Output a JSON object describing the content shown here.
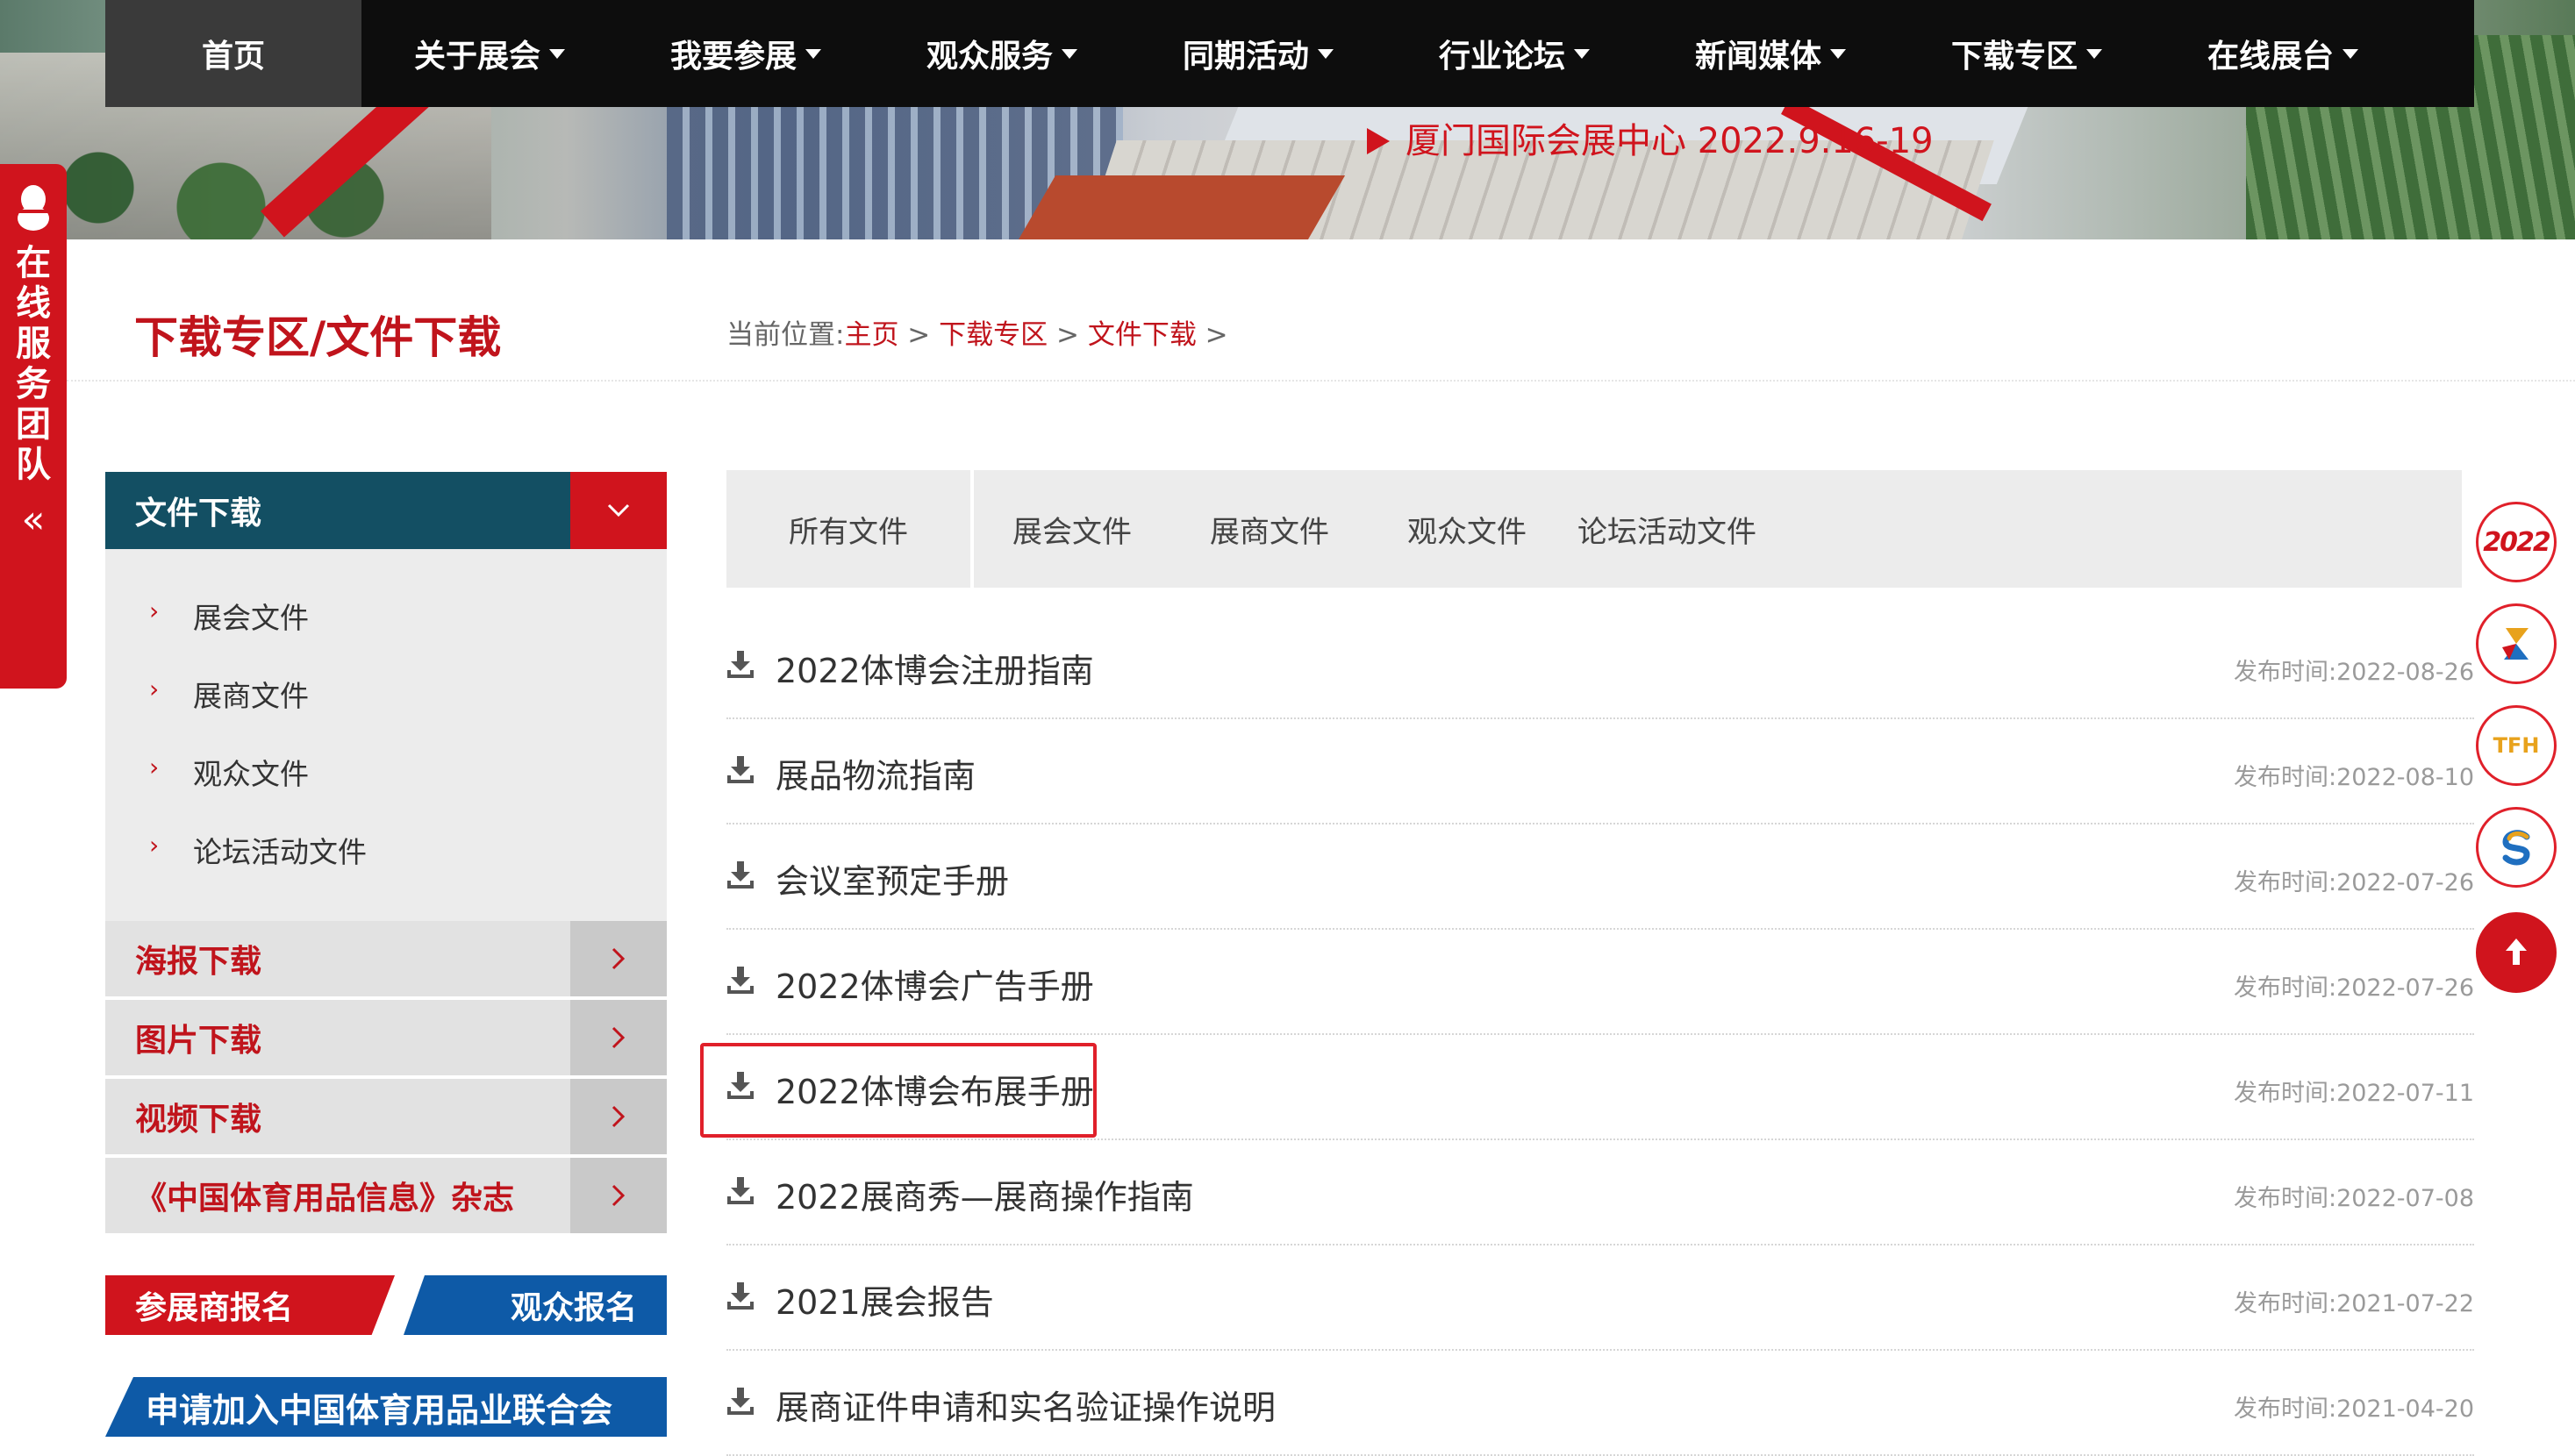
{
  "nav": {
    "items": [
      {
        "label": "首页",
        "active": true,
        "dropdown": false
      },
      {
        "label": "关于展会",
        "dropdown": true
      },
      {
        "label": "我要参展",
        "dropdown": true
      },
      {
        "label": "观众服务",
        "dropdown": true
      },
      {
        "label": "同期活动",
        "dropdown": true
      },
      {
        "label": "行业论坛",
        "dropdown": true
      },
      {
        "label": "新闻媒体",
        "dropdown": true
      },
      {
        "label": "下载专区",
        "dropdown": true
      },
      {
        "label": "在线展台",
        "dropdown": true
      }
    ]
  },
  "banner": {
    "venue_date": "厦门国际会展中心 2022.9.16-19"
  },
  "service_tab": {
    "label": "在线服务团队",
    "collapse_symbol": "«"
  },
  "page": {
    "title": "下载专区/文件下载",
    "breadcrumb": {
      "prefix": "当前位置:",
      "items": [
        "主页",
        "下载专区",
        "文件下载"
      ],
      "sep": " > "
    }
  },
  "sidebar": {
    "header": "文件下载",
    "sub_items": [
      "展会文件",
      "展商文件",
      "观众文件",
      "论坛活动文件"
    ],
    "sections": [
      "海报下载",
      "图片下载",
      "视频下载",
      "《中国体育用品信息》杂志"
    ],
    "register_exhibitor": "参展商报名",
    "register_visitor": "观众报名",
    "join_banner": "申请加入中国体育用品业联合会"
  },
  "tabs": [
    "所有文件",
    "展会文件",
    "展商文件",
    "观众文件",
    "论坛活动文件"
  ],
  "files": [
    {
      "name": "2022体博会注册指南",
      "date": "发布时间:2022-08-26"
    },
    {
      "name": "展品物流指南",
      "date": "发布时间:2022-08-10"
    },
    {
      "name": "会议室预定手册",
      "date": "发布时间:2022-07-26"
    },
    {
      "name": "2022体博会广告手册",
      "date": "发布时间:2022-07-26"
    },
    {
      "name": "2022体博会布展手册",
      "date": "发布时间:2022-07-11",
      "highlighted": true
    },
    {
      "name": "2022展商秀—展商操作指南",
      "date": "发布时间:2022-07-08"
    },
    {
      "name": "2021展会报告",
      "date": "发布时间:2021-07-22"
    },
    {
      "name": "展商证件申请和实名验证操作说明",
      "date": "发布时间:2021-04-20"
    }
  ],
  "floating": {
    "logos": [
      "2022",
      "TFH"
    ]
  },
  "colors": {
    "accent": "#d0141d",
    "teal": "#134f63",
    "blue": "#0e5aa7"
  }
}
